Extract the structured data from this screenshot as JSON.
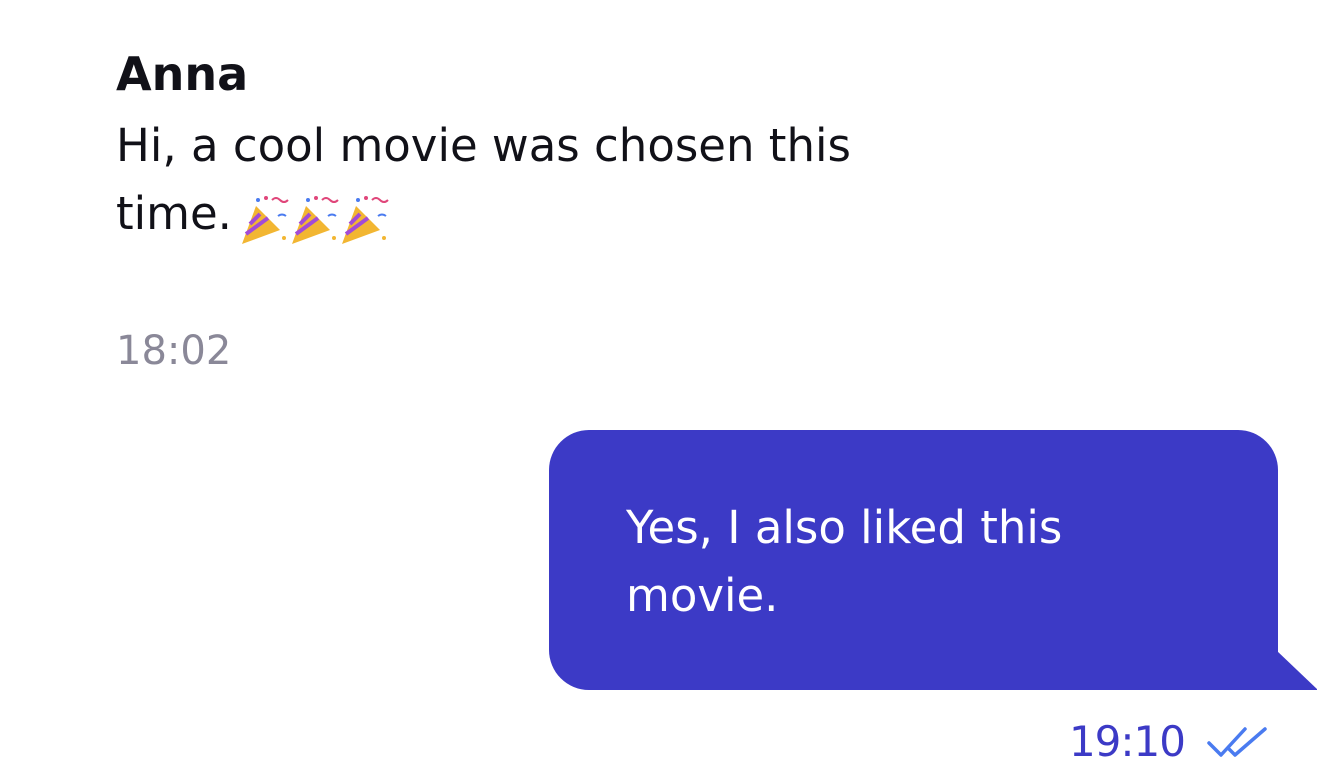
{
  "incoming": {
    "sender": "Anna",
    "text": "Hi, a cool movie was chosen this time.",
    "emoji": "🎉🎉🎉",
    "time": "18:02"
  },
  "outgoing": {
    "text": "Yes, I also liked this movie.",
    "time": "19:10",
    "status_icon": "double-check-icon"
  },
  "colors": {
    "bubble": "#3c3ac6",
    "time_incoming": "#8a8898",
    "check": "#4a7bf0"
  }
}
